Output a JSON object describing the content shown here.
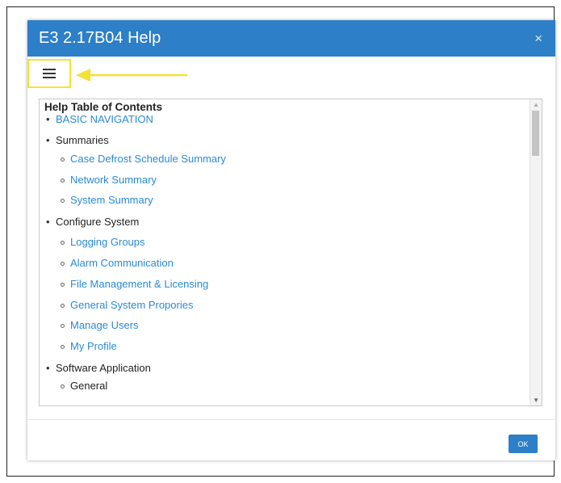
{
  "window": {
    "title": "E3 2.17B04 Help",
    "close_glyph": "×"
  },
  "menu_button": {
    "icon": "hamburger-menu-icon"
  },
  "annotation": {
    "color": "#f4e233",
    "icon": "arrow-left-icon"
  },
  "toc": {
    "title": "Help Table of Contents",
    "entries": {
      "basic_navigation": "BASIC NAVIGATION",
      "summaries": "Summaries",
      "case_defrost": "Case Defrost Schedule Summary",
      "network_summary": "Network Summary",
      "system_summary": "System Summary",
      "configure_system": "Configure System",
      "logging_groups": "Logging Groups",
      "alarm_communication": "Alarm Communication",
      "file_management": "File Management & Licensing",
      "general_system_properties": "General System Propories",
      "manage_users": "Manage Users",
      "my_profile": "My Profile",
      "software_application": "Software Application",
      "general": "General"
    }
  },
  "footer": {
    "ok_label": "OK"
  },
  "colors": {
    "titlebar": "#2d7fc7",
    "link": "#2a8ad6"
  }
}
